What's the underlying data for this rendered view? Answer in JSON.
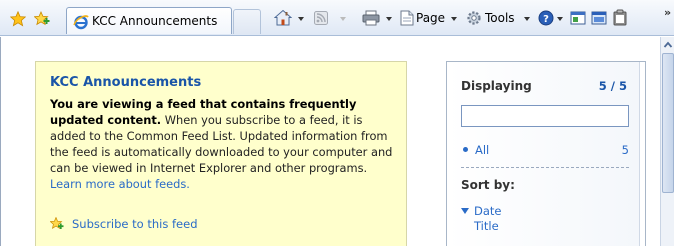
{
  "toolbar": {
    "favorites_icon": "favorites-star-icon",
    "add_favorites_icon": "add-favorites-icon",
    "tab_title": "KCC Announcements",
    "tab_icon": "ie-page-icon",
    "home_icon": "home-icon",
    "feeds_icon": "feeds-icon",
    "print_icon": "print-icon",
    "page_label": "Page",
    "tools_label": "Tools",
    "help_icon": "help-icon",
    "overflow": "»"
  },
  "feed": {
    "title": "KCC Announcements",
    "lead": "You are viewing a feed that contains frequently updated content.",
    "body": " When you subscribe to a feed, it is added to the Common Feed List. Updated information from the feed is automatically downloaded to your computer and can be viewed in Internet Explorer and other programs. ",
    "learn_more": "Learn more about feeds.",
    "subscribe": "Subscribe to this feed"
  },
  "filter": {
    "displaying_label": "Displaying",
    "displaying_count": "5 / 5",
    "search_value": "",
    "categories": [
      {
        "label": "All",
        "count": "5"
      }
    ],
    "sort_by_label": "Sort by:",
    "sort_options": [
      "Date",
      "Title"
    ],
    "active_sort": "Date"
  },
  "colors": {
    "feed_background": "#ffffcc",
    "link": "#2a6bc7",
    "title": "#1a55a8"
  }
}
